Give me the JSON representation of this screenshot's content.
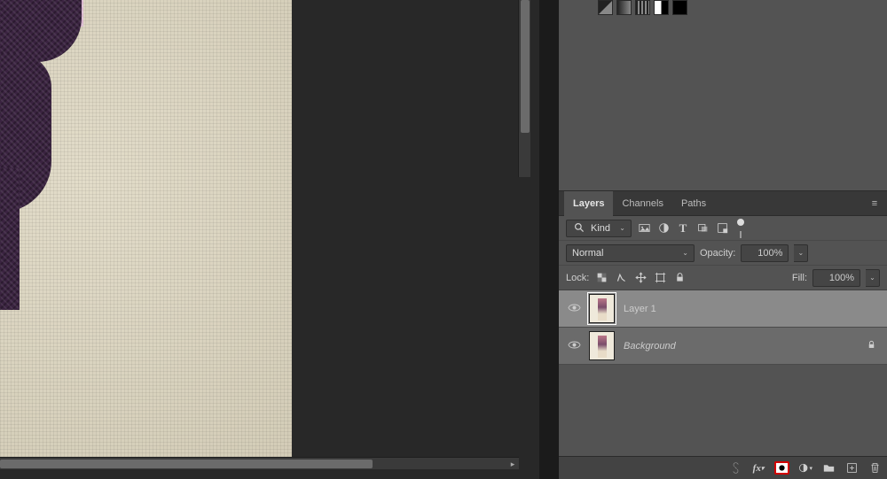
{
  "tabs": {
    "layers": "Layers",
    "channels": "Channels",
    "paths": "Paths"
  },
  "filter": {
    "kind": "Kind"
  },
  "blend": {
    "mode": "Normal",
    "opacity_label": "Opacity:",
    "opacity_value": "100%"
  },
  "lock": {
    "label": "Lock:",
    "fill_label": "Fill:",
    "fill_value": "100%"
  },
  "layers": [
    {
      "name": "Layer 1",
      "visible": true,
      "selected": true,
      "locked": false
    },
    {
      "name": "Background",
      "visible": true,
      "selected": false,
      "locked": true,
      "bg": true
    }
  ],
  "icons": {
    "search": "search",
    "image": "image",
    "adjust": "adjust",
    "type": "T",
    "shape": "shape",
    "smart": "smart",
    "link": "link",
    "fx": "fx",
    "mask": "mask",
    "fill_adj": "fill-adjust",
    "group": "group",
    "new": "new",
    "trash": "trash",
    "lock_px": "lock-pixels",
    "brush": "brush",
    "move": "move",
    "artboard": "artboard",
    "lock_all": "lock"
  }
}
